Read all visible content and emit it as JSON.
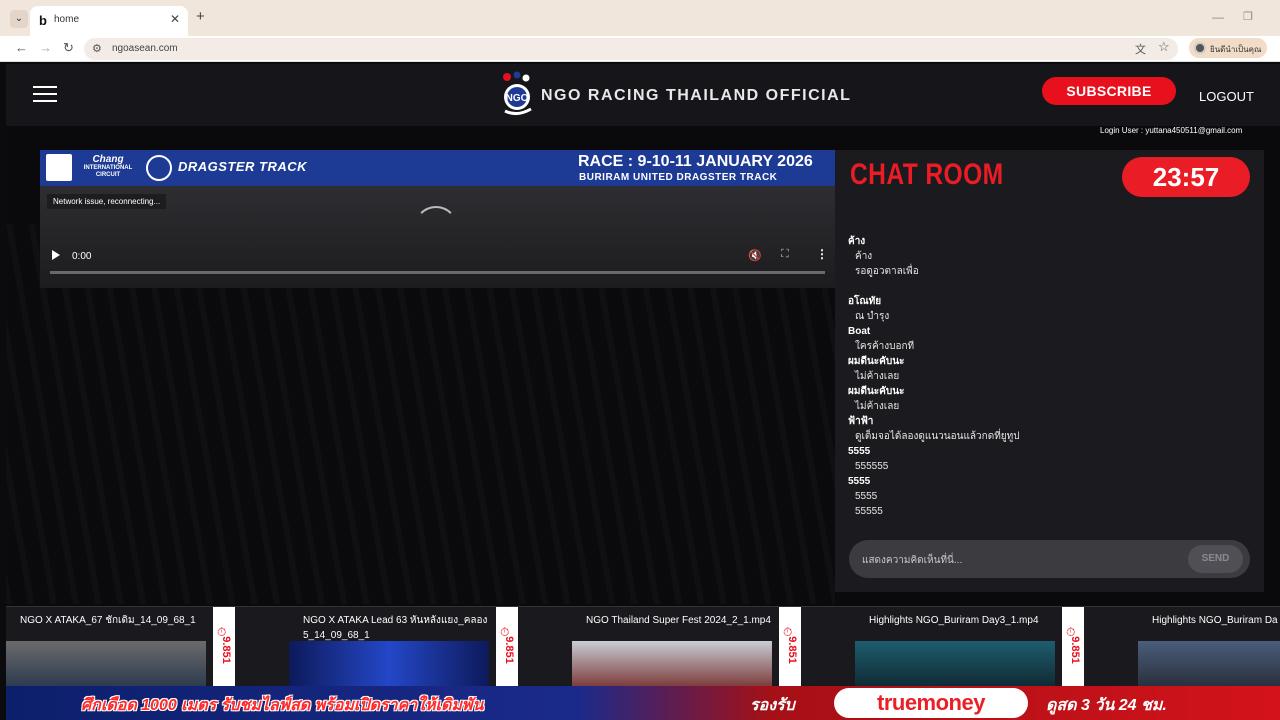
{
  "browser": {
    "tab_title": "home",
    "favicon": "b",
    "url": "ngoasean.com",
    "profile_label": "ยินดีนำเป็นคุณ"
  },
  "header": {
    "title": "NGO RACING THAILAND OFFICIAL",
    "subscribe_label": "SUBSCRIBE",
    "logout_label": "LOGOUT",
    "login_user": "Login User : yuttana450511@gmail.com"
  },
  "video": {
    "banner_brand": "Chang",
    "banner_brand_sub": "INTERNATIONAL CIRCUIT",
    "banner_track_logo": "DRAGSTER TRACK",
    "banner_race": "RACE : 9-10-11 JANUARY 2026",
    "banner_track": "BURIRAM UNITED DRAGSTER TRACK",
    "status": "Network issue, reconnecting...",
    "time": "0:00"
  },
  "chat": {
    "title": "CHAT ROOM",
    "timer": "23:57",
    "messages": [
      {
        "user": "ค้าง",
        "texts": [
          "ค้าง",
          "รอดูอวตาลเพื่อ",
          ""
        ]
      },
      {
        "user": "อโณทัย",
        "texts": [
          "ณ บำรุง"
        ]
      },
      {
        "user": "Boat",
        "texts": [
          "ใครค้างบอกที"
        ]
      },
      {
        "user": "ผมดีนะคับนะ",
        "texts": [
          "ไม่ค้างเลย"
        ]
      },
      {
        "user": "ผมดีนะคับนะ",
        "texts": [
          "ไม่ค้างเลย"
        ]
      },
      {
        "user": "ฟ้าฟ้า",
        "texts": [
          "ดูเต็มจอได้ลองดูแนวนอนแล้วกดที่ยูทูป"
        ]
      },
      {
        "user": "5555",
        "texts": [
          "555555"
        ]
      },
      {
        "user": "5555",
        "texts": [
          "5555",
          "55555"
        ]
      }
    ],
    "input_placeholder": "แสดงความคิดเห็นที่นี่...",
    "send_label": "SEND"
  },
  "videos": [
    {
      "title": "NGO X ATAKA_67 ชักเดิม_14_09_68_1",
      "views": "9.851"
    },
    {
      "title": "NGO X ATAKA Lead 63 หันหลังแยง_คลอง 5_14_09_68_1",
      "views": "9.851"
    },
    {
      "title": "NGO Thailand Super Fest 2024_2_1.mp4",
      "views": "9.851"
    },
    {
      "title": "Highlights NGO_Buriram Day3_1.mp4",
      "views": "9.851"
    },
    {
      "title": "Highlights NGO_Buriram Da",
      "views": ""
    }
  ],
  "promo": {
    "left": "ศึกเดือด 1000 เมตร รับชมไลฟ์สด พร้อมเปิดราคาให้เดิมพัน",
    "mid": "รองรับ",
    "brand": "truemoney",
    "right": "ดูสด 3 วัน 24 ชม."
  },
  "colors": {
    "accent_red": "#ea1c25",
    "banner_blue": "#1d3a94",
    "panel_dark": "#1b1b1f"
  }
}
